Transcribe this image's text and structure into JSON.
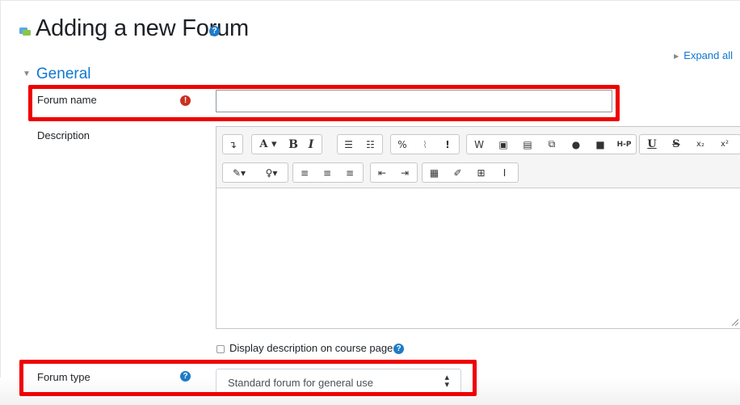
{
  "header": {
    "title": "Adding a new Forum",
    "expand_all": "Expand all"
  },
  "section": {
    "title": "General"
  },
  "fields": {
    "forum_name": {
      "label": "Forum name",
      "value": ""
    },
    "description": {
      "label": "Description",
      "value": ""
    },
    "display_description": {
      "label": "Display description on course page",
      "checked": false
    },
    "forum_type": {
      "label": "Forum type",
      "selected": "Standard forum for general use"
    }
  },
  "toolbar": {
    "row1": [
      [
        "collapse-icon"
      ],
      [
        "font-size-icon",
        "bold-icon",
        "italic-icon"
      ],
      [
        "bullet-list-icon",
        "numbered-list-icon"
      ],
      [
        "link-icon",
        "unlink-icon",
        "emoji-icon"
      ],
      [
        "word-paste-icon",
        "image-icon",
        "media-icon",
        "manage-files-icon",
        "record-audio-icon",
        "record-video-icon",
        "h5p-icon"
      ],
      [
        "underline-icon",
        "strikethrough-icon",
        "subscript-icon",
        "superscript-icon"
      ]
    ],
    "row2": [
      [
        "font-color-icon",
        "background-color-icon"
      ],
      [
        "align-left-icon",
        "align-center-icon",
        "align-right-icon"
      ],
      [
        "outdent-icon",
        "indent-icon"
      ],
      [
        "equation-icon",
        "special-chars-icon",
        "table-icon",
        "clear-formatting-icon"
      ]
    ],
    "labels": {
      "font_size": "A ▾",
      "bold": "B",
      "italic": "I",
      "h5p": "H-P",
      "underline": "U",
      "strike": "S",
      "subscript": "x₂",
      "superscript": "x²"
    }
  },
  "colors": {
    "accent": "#1177d1",
    "error": "#ca3120",
    "highlight": "#ee0000"
  }
}
